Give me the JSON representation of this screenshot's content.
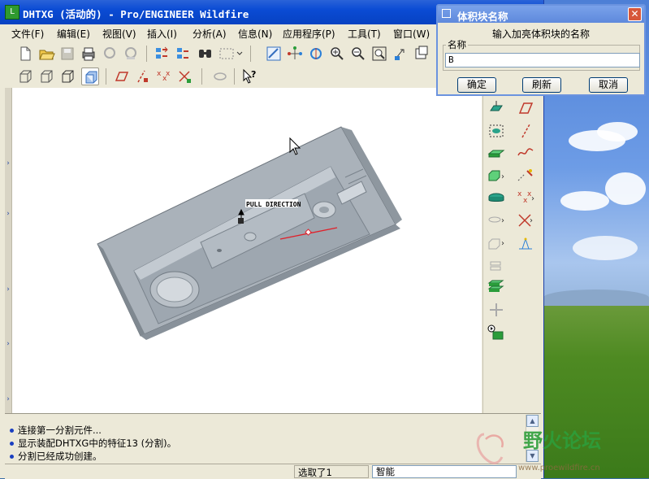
{
  "window": {
    "title": "DHTXG (活动的) - Pro/ENGINEER Wildfire"
  },
  "menubar": {
    "items": [
      "文件(F)",
      "编辑(E)",
      "视图(V)",
      "插入(I)",
      "分析(A)",
      "信息(N)",
      "应用程序(P)",
      "工具(T)",
      "窗口(W)"
    ]
  },
  "canvas": {
    "annotation": "PULL DIRECTION"
  },
  "messages": [
    "连接第一分割元件...",
    "显示装配DHTXG中的特征13 (分割)。",
    "分割已经成功创建。"
  ],
  "statusbar": {
    "selected": "选取了1",
    "filter": "智能"
  },
  "dialog": {
    "title": "体积块名称",
    "prompt": "输入加亮体积块的名称",
    "group_label": "名称",
    "input_value": "B",
    "ok_label": "确定",
    "refresh_label": "刷新",
    "cancel_label": "取消"
  },
  "watermark": {
    "brand": "野火论坛",
    "url": "www.proewildfire.cn"
  },
  "colors": {
    "titlebar": "#0a4bd4",
    "dialog_titlebar": "#6a92e0",
    "canvas": "#ffffff",
    "model": "#9aa3ab"
  }
}
